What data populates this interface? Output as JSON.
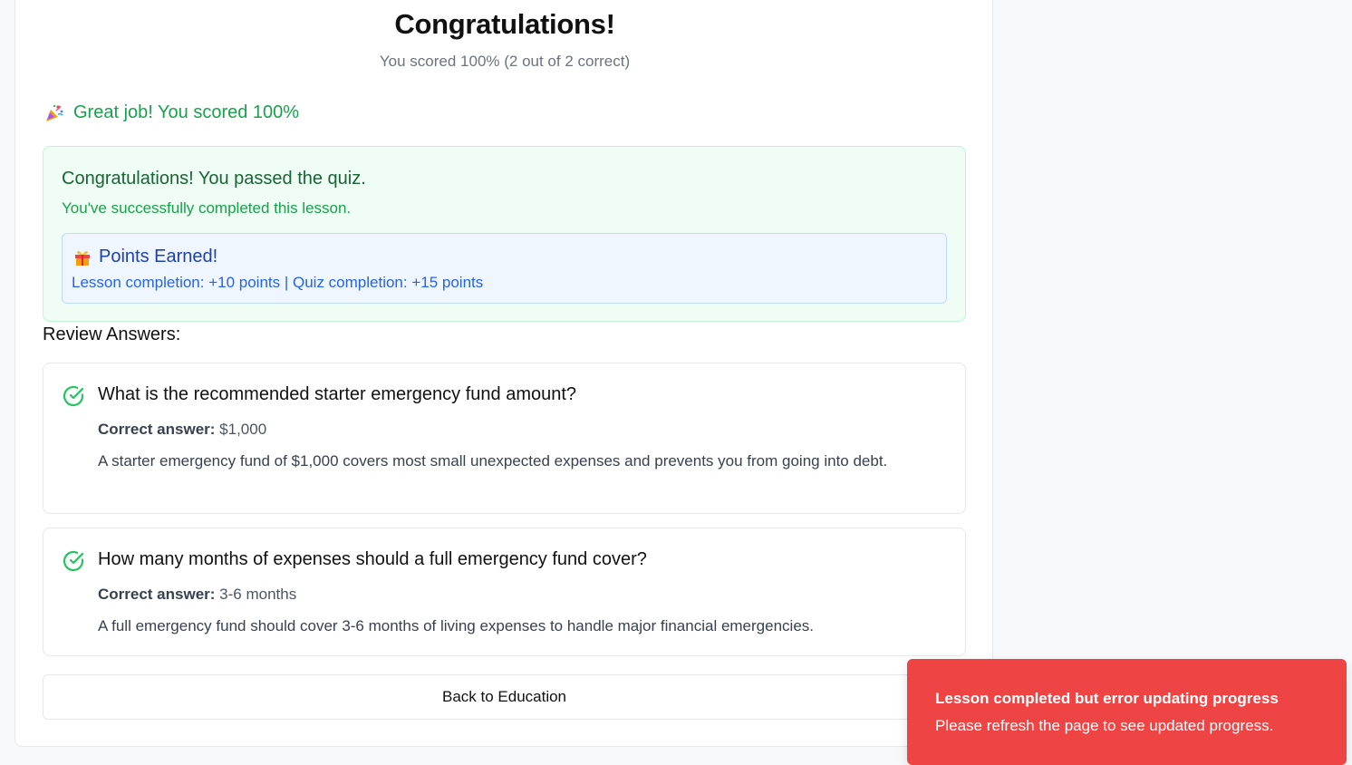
{
  "header": {
    "title": "Congratulations!",
    "subtitle": "You scored 100% (2 out of 2 correct)"
  },
  "score_message": {
    "icon": "party-popper-icon",
    "text": "Great job! You scored 100%"
  },
  "pass_box": {
    "title": "Congratulations! You passed the quiz.",
    "subtitle": "You've successfully completed this lesson.",
    "points": {
      "icon": "gift-icon",
      "title": "Points Earned!",
      "detail": "Lesson completion: +10 points | Quiz completion: +15 points"
    }
  },
  "review": {
    "heading": "Review Answers:",
    "answer_label": "Correct answer:",
    "items": [
      {
        "question": "What is the recommended starter emergency fund amount?",
        "answer": "$1,000",
        "explanation": "A starter emergency fund of $1,000 covers most small unexpected expenses and prevents you from going into debt.",
        "status": "correct"
      },
      {
        "question": "How many months of expenses should a full emergency fund cover?",
        "answer": "3-6 months",
        "explanation": "A full emergency fund should cover 3-6 months of living expenses to handle major financial emergencies.",
        "status": "correct"
      }
    ]
  },
  "back_button": {
    "label": "Back to Education"
  },
  "toast": {
    "title": "Lesson completed but error updating progress",
    "message": "Please refresh the page to see updated progress.",
    "color": "#ef4444"
  },
  "colors": {
    "success": "#16a34a",
    "success_dark": "#166534",
    "info": "#2563eb"
  }
}
